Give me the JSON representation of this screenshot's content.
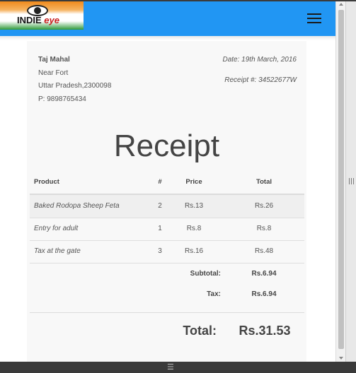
{
  "header": {
    "logo_main": "INDIE",
    "logo_sub": "eye",
    "colors": {
      "bar": "#2196f3",
      "logo_orange": "#f08a1c",
      "logo_green": "#2f9a3a"
    },
    "menu_icon": "hamburger-menu-icon"
  },
  "receipt": {
    "address": {
      "name": "Taj Mahal",
      "line1": "Near Fort",
      "line2": "Uttar Pradesh,2300098",
      "phone": "P: 9898765434"
    },
    "date": "Date: 19th March, 2016",
    "receipt_no": "Receipt #: 34522677W",
    "title": "Receipt",
    "columns": {
      "product": "Product",
      "qty": "#",
      "price": "Price",
      "total": "Total"
    },
    "items": [
      {
        "product": "Baked Rodopa Sheep Feta",
        "qty": "2",
        "price": "Rs.13",
        "total": "Rs.26"
      },
      {
        "product": "Entry for adult",
        "qty": "1",
        "price": "Rs.8",
        "total": "Rs.8"
      },
      {
        "product": "Tax at the gate",
        "qty": "3",
        "price": "Rs.16",
        "total": "Rs.48"
      }
    ],
    "subtotal_label": "Subtotal:",
    "subtotal_value": "Rs.6.94",
    "tax_label": "Tax:",
    "tax_value": "Rs.6.94",
    "total_label": "Total:",
    "total_value": "Rs.31.53"
  },
  "chrome": {
    "side_grip": "|||",
    "bottom_grip": "☰"
  }
}
